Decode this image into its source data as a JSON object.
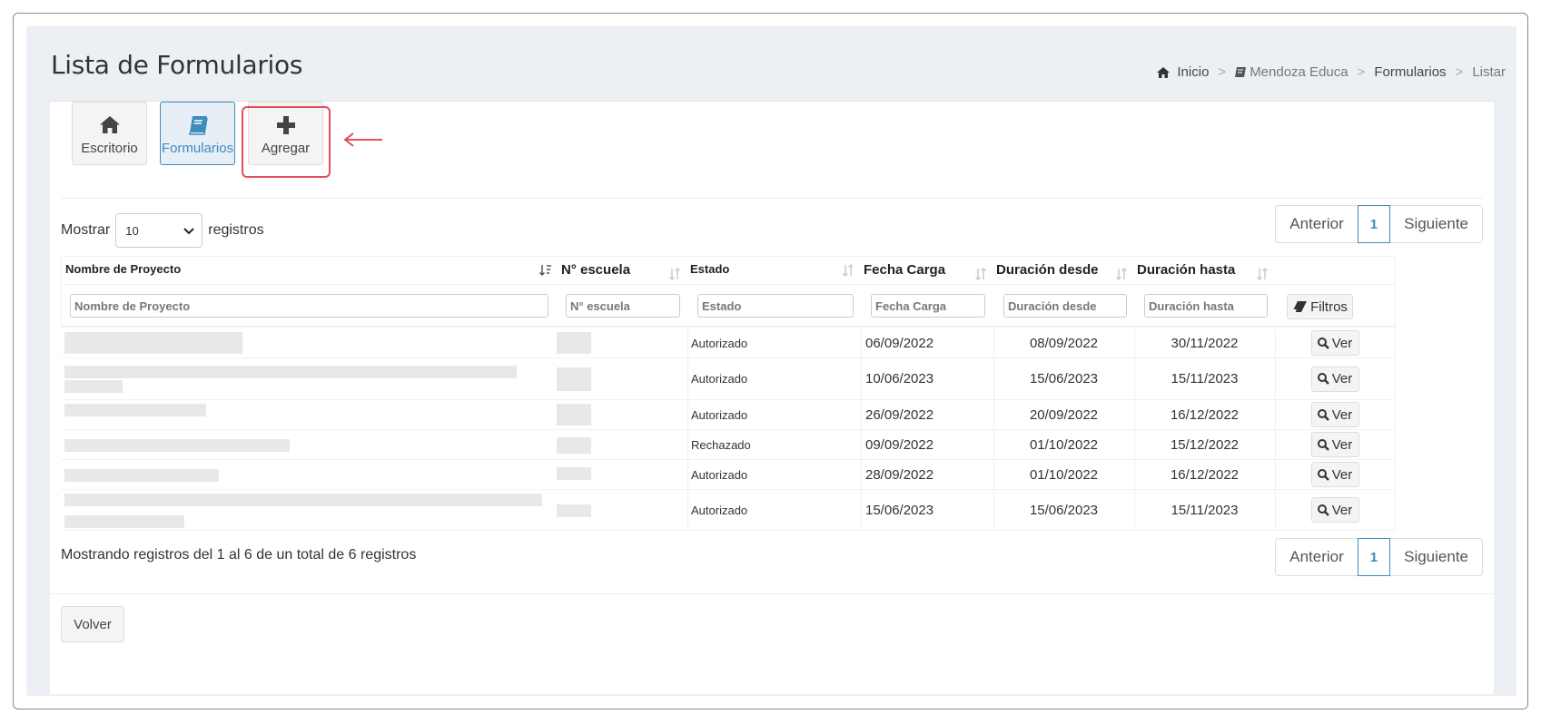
{
  "header": {
    "title": "Lista de Formularios",
    "breadcrumb": [
      {
        "label": "Inicio",
        "icon": "home-icon"
      },
      {
        "label": "Mendoza Educa",
        "icon": "book-icon"
      },
      {
        "label": "Formularios"
      },
      {
        "label": "Listar"
      }
    ]
  },
  "toolbar": {
    "tiles": [
      {
        "label": "Escritorio",
        "icon": "home-icon"
      },
      {
        "label": "Formularios",
        "icon": "book-icon",
        "active": true
      },
      {
        "label": "Agregar",
        "icon": "plus-icon"
      }
    ]
  },
  "length": {
    "prefix": "Mostrar",
    "value": "10",
    "suffix": "registros"
  },
  "pagination": {
    "prev": "Anterior",
    "current": "1",
    "next": "Siguiente"
  },
  "table": {
    "columns": [
      "Nombre de Proyecto",
      "N° escuela",
      "Estado",
      "Fecha Carga",
      "Duración desde",
      "Duración hasta"
    ],
    "filters": [
      "Nombre de Proyecto",
      "N° escuela",
      "Estado",
      "Fecha Carga",
      "Duración desde",
      "Duración hasta"
    ],
    "filter_button": "Filtros",
    "view_button": "Ver",
    "rows": [
      {
        "estado": "Autorizado",
        "fecha": "06/09/2022",
        "desde": "08/09/2022",
        "hasta": "30/11/2022"
      },
      {
        "estado": "Autorizado",
        "fecha": "10/06/2023",
        "desde": "15/06/2023",
        "hasta": "15/11/2023"
      },
      {
        "estado": "Autorizado",
        "fecha": "26/09/2022",
        "desde": "20/09/2022",
        "hasta": "16/12/2022"
      },
      {
        "estado": "Rechazado",
        "fecha": "09/09/2022",
        "desde": "01/10/2022",
        "hasta": "15/12/2022"
      },
      {
        "estado": "Autorizado",
        "fecha": "28/09/2022",
        "desde": "01/10/2022",
        "hasta": "16/12/2022"
      },
      {
        "estado": "Autorizado",
        "fecha": "15/06/2023",
        "desde": "15/06/2023",
        "hasta": "15/11/2023"
      }
    ]
  },
  "info": "Mostrando registros del 1 al 6 de un total de 6 registros",
  "footer": {
    "back": "Volver"
  },
  "colors": {
    "accent": "#3c8dbc",
    "highlight": "#e0505a"
  }
}
